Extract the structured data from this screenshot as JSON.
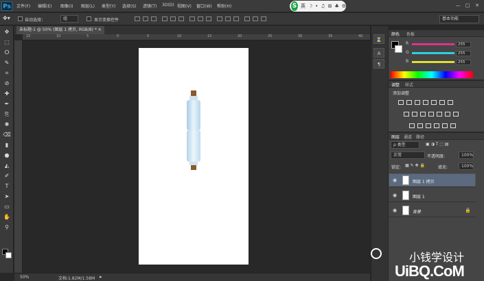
{
  "app": {
    "logo": "Ps"
  },
  "menu": [
    "文件(F)",
    "编辑(E)",
    "图像(I)",
    "图层(L)",
    "类型(Y)",
    "选择(S)",
    "滤镜(T)",
    "3D(D)",
    "视图(V)",
    "窗口(W)",
    "帮助(H)"
  ],
  "window_controls": [
    "—",
    "□",
    "✕"
  ],
  "ime": {
    "logo": "S",
    "lang": "英",
    "icons": [
      "☽",
      "•",
      "♫",
      "⊞",
      "♣",
      "⚙"
    ]
  },
  "options_bar": {
    "auto_select_label": "自动选择：",
    "auto_select_value": "组",
    "show_transform_label": "显示变换控件",
    "workspace": "基本功能"
  },
  "document": {
    "tab_title": "未标题-1 @ 50% (图层 1 拷贝, RGB/8) *",
    "close_glyph": "✕"
  },
  "ruler_labels": [
    "15",
    "10",
    "5",
    "0",
    "5",
    "10",
    "15",
    "20",
    "25",
    "30",
    "35",
    "40"
  ],
  "status": {
    "zoom": "50%",
    "doc_size": "文档:1.82M/1.58M"
  },
  "color_panel": {
    "tabs": [
      "颜色",
      "色板"
    ],
    "channels": [
      {
        "label": "R",
        "value": "255",
        "color": "#e0328c"
      },
      {
        "label": "G",
        "value": "255",
        "color": "#2fd0e0"
      },
      {
        "label": "B",
        "value": "255",
        "color": "#e0e030"
      }
    ]
  },
  "adjust_panel": {
    "tabs": [
      "调整",
      "样式"
    ],
    "add_label": "添加调整"
  },
  "layers_panel": {
    "tabs": [
      "图层",
      "通道",
      "路径"
    ],
    "filter_label": "ρ 类型",
    "blend_mode": "正常",
    "opacity_label": "不透明度:",
    "opacity_value": "100%",
    "lock_label": "锁定:",
    "fill_label": "填充:",
    "fill_value": "100%",
    "layers": [
      {
        "name": "图层 1 拷贝",
        "selected": true
      },
      {
        "name": "图层 1",
        "selected": false
      },
      {
        "name": "背景",
        "selected": false,
        "italic": true
      }
    ]
  },
  "watermark": {
    "text": "小钱学设计",
    "site": "UiBQ.CoM"
  }
}
